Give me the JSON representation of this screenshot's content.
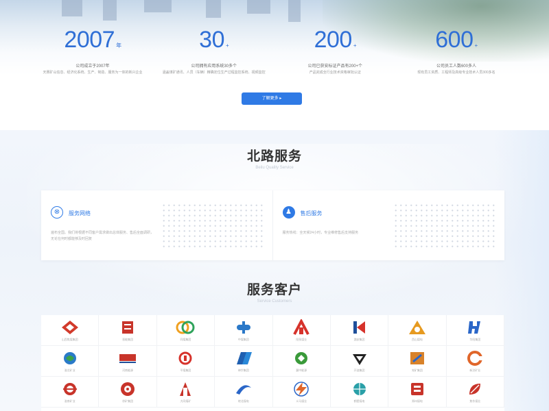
{
  "stats": [
    {
      "number": "2007",
      "unit": "年",
      "line1": "公司成立于2007年",
      "line2": "天赛矿山信息、经济化系统、生产、制造、服务为一体的新兴企业"
    },
    {
      "number": "30",
      "unit": "+",
      "line1": "公司拥有应用系统30多个",
      "line2": "涵盖煤矿通讯、人员（车辆）精确定位生产过程监控系统、视频监控"
    },
    {
      "number": "200",
      "unit": "+",
      "line1": "公司已获安标证产品有200+个",
      "line2": "产品完成全行业技术资格审批认证"
    },
    {
      "number": "600",
      "unit": "+",
      "line1": "公司员工人数600多人",
      "line2": "现有员工资质、工程师及高级专业技术人员300多名"
    }
  ],
  "more_button": "了解更多 ▸",
  "service": {
    "title": "北路服务",
    "subtitle": "Beilu Quality Service",
    "cards": [
      {
        "icon": "network-icon",
        "title": "服务网络",
        "desc": "遍布全国。我们将根据不同客户需求做出总体服务、售后全面调研，无论在何时都能够及时回复"
      },
      {
        "icon": "aftersales-icon",
        "title": "售后服务",
        "desc": "服务热线：全天候24小时，专业维修售后支持服务"
      }
    ]
  },
  "clients": {
    "title": "服务客户",
    "subtitle": "Service Customers",
    "items": [
      {
        "name": "山西焦煤集团",
        "color": "#d23a2b",
        "shape": "diamond"
      },
      {
        "name": "晋能集团",
        "color": "#c8342a",
        "shape": "jin"
      },
      {
        "name": "同煤集团",
        "color": "#2fa35b",
        "shape": "rings"
      },
      {
        "name": "中煤集团",
        "color": "#2a78c8",
        "shape": "zhong"
      },
      {
        "name": "阳泉煤业",
        "color": "#d6322b",
        "shape": "arch"
      },
      {
        "name": "潞安集团",
        "color": "#1f4f9a",
        "shape": "k"
      },
      {
        "name": "西山煤电",
        "color": "#e69a20",
        "shape": "triangle"
      },
      {
        "name": "华阳集团",
        "color": "#2a66c8",
        "shape": "h"
      },
      {
        "name": "淮北矿业",
        "color": "#2a7ac8",
        "shape": "swirl"
      },
      {
        "name": "河南能源",
        "color": "#c8342a",
        "shape": "henan"
      },
      {
        "name": "平煤集团",
        "color": "#d6322b",
        "shape": "ring"
      },
      {
        "name": "神华集团",
        "color": "#1f5fb0",
        "shape": "slash"
      },
      {
        "name": "冀中能源",
        "color": "#3a9a3a",
        "shape": "flower"
      },
      {
        "name": "开滦集团",
        "color": "#222222",
        "shape": "gem"
      },
      {
        "name": "兖矿集团",
        "color": "#d8822a",
        "shape": "square"
      },
      {
        "name": "新汶矿业",
        "color": "#e0662a",
        "shape": "c"
      },
      {
        "name": "淮南矿业",
        "color": "#c8342a",
        "shape": "double"
      },
      {
        "name": "徐矿集团",
        "color": "#c8342a",
        "shape": "gear"
      },
      {
        "name": "大同煤矿",
        "color": "#c8342a",
        "shape": "tower"
      },
      {
        "name": "皖北煤电",
        "color": "#2a66c8",
        "shape": "wing"
      },
      {
        "name": "义马煤业",
        "color": "#2a66c8",
        "shape": "bolt"
      },
      {
        "name": "鹤壁煤电",
        "color": "#2aa0a8",
        "shape": "globe"
      },
      {
        "name": "郑州煤电",
        "color": "#c8342a",
        "shape": "seal"
      },
      {
        "name": "焦作煤业",
        "color": "#c8342a",
        "shape": "leaf"
      }
    ]
  }
}
